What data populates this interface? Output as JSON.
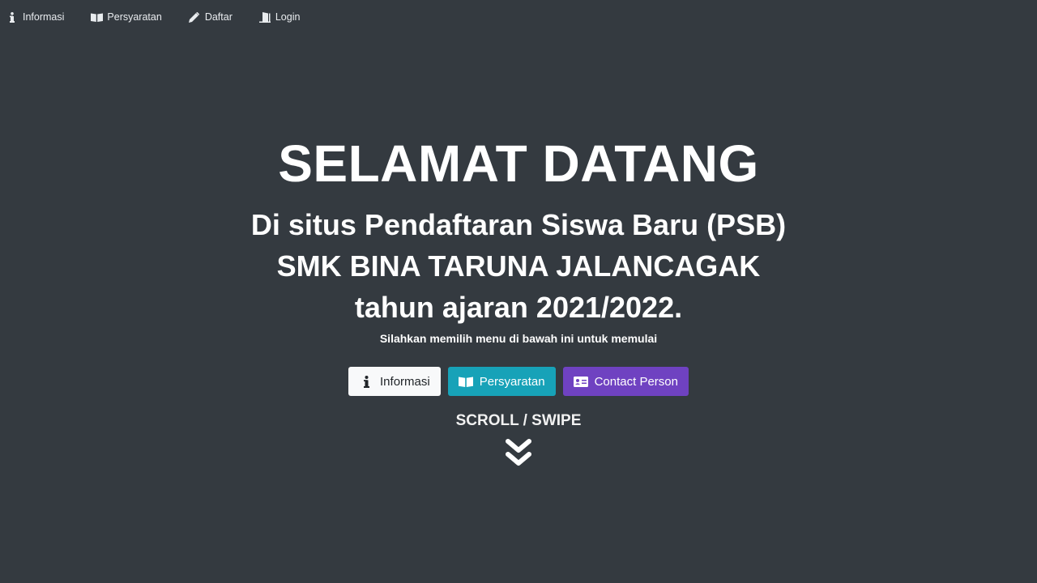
{
  "nav": {
    "items": [
      {
        "label": "Informasi",
        "icon": "info-icon"
      },
      {
        "label": "Persyaratan",
        "icon": "book-icon"
      },
      {
        "label": "Daftar",
        "icon": "pencil-icon"
      },
      {
        "label": "Login",
        "icon": "door-open-icon"
      }
    ]
  },
  "hero": {
    "title": "SELAMAT DATANG",
    "subtitle_line1": "Di situs Pendaftaran Siswa Baru (PSB)",
    "subtitle_line2": "SMK BINA TARUNA JALANCAGAK",
    "subtitle_line3": "tahun ajaran 2021/2022.",
    "instruction": "Silahkan memilih menu di bawah ini untuk memulai"
  },
  "buttons": [
    {
      "label": "Informasi",
      "icon": "info-icon"
    },
    {
      "label": "Persyaratan",
      "icon": "book-icon"
    },
    {
      "label": "Contact Person",
      "icon": "id-card-icon"
    }
  ],
  "scroll": {
    "label": "SCROLL / SWIPE",
    "icon": "double-chevron-down-icon"
  },
  "colors": {
    "background": "#343a40",
    "light_button": "#f8f9fa",
    "info_button": "#17a2b8",
    "purple_button": "#6f42c1"
  }
}
